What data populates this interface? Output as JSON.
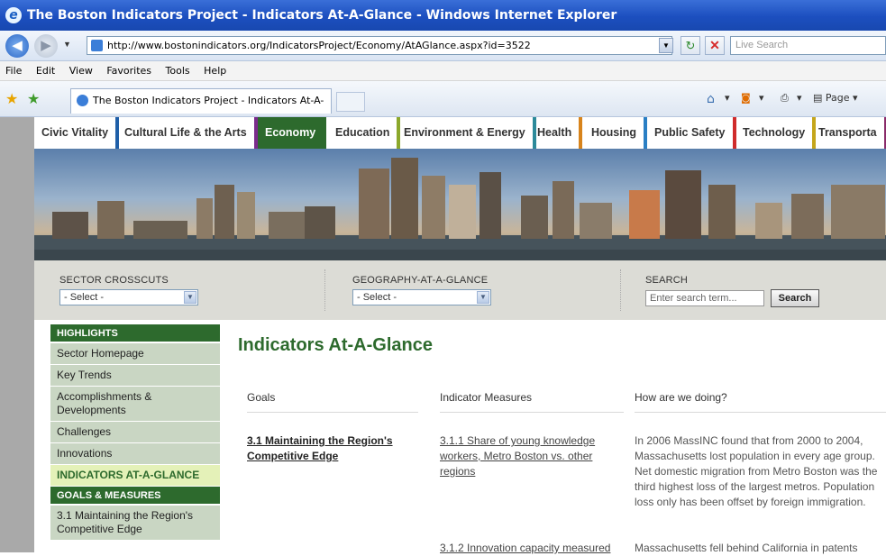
{
  "window": {
    "title": "The Boston Indicators Project - Indicators At-A-Glance - Windows Internet Explorer"
  },
  "browser": {
    "address": "http://www.bostonindicators.org/IndicatorsProject/Economy/AtAGlance.aspx?id=3522",
    "search_placeholder": "Live Search",
    "menu": [
      "File",
      "Edit",
      "View",
      "Favorites",
      "Tools",
      "Help"
    ],
    "tab_title": "The Boston Indicators Project - Indicators At-A-Glance",
    "page_menu": "Page"
  },
  "site": {
    "nav": [
      {
        "label": "Civic Vitality",
        "color": "#1f5fa8"
      },
      {
        "label": "Cultural Life & the Arts",
        "color": "#7b2b8c"
      },
      {
        "label": "Economy",
        "color": "#2d6a2d",
        "active": true
      },
      {
        "label": "Education",
        "color": "#8ca82b"
      },
      {
        "label": "Environment & Energy",
        "color": "#2c8a9a"
      },
      {
        "label": "Health",
        "color": "#d8841b"
      },
      {
        "label": "Housing",
        "color": "#2a7fc4"
      },
      {
        "label": "Public Safety",
        "color": "#d02b2b"
      },
      {
        "label": "Technology",
        "color": "#c5a61b"
      },
      {
        "label": "Transporta",
        "color": "#8a2b6a"
      }
    ],
    "tools": {
      "sector_label": "SECTOR CROSSCUTS",
      "sector_value": "- Select -",
      "geo_label": "GEOGRAPHY-AT-A-GLANCE",
      "geo_value": "- Select -",
      "search_label": "SEARCH",
      "search_placeholder": "Enter search term...",
      "search_button": "Search"
    },
    "sidebar": {
      "head1": "HIGHLIGHTS",
      "items": [
        "Sector Homepage",
        "Key Trends",
        "Accomplishments & Developments",
        "Challenges",
        "Innovations"
      ],
      "active": "INDICATORS AT-A-GLANCE",
      "head2": "GOALS & MEASURES",
      "goal_item": "3.1 Maintaining the Region's Competitive Edge"
    },
    "main": {
      "title": "Indicators At-A-Glance",
      "col_goals": "Goals",
      "col_measures": "Indicator Measures",
      "col_doing": "How are we doing?",
      "goal": "3.1 Maintaining the Region's Competitive Edge",
      "measure1": "3.1.1 Share of young knowledge workers, Metro Boston vs. other regions",
      "doing1": "In 2006 MassINC found that from 2000 to 2004, Massachusetts lost population in every age group. Net domestic migration from Metro Boston was the third highest loss of the largest metros. Population loss only has been offset by foreign immigration.",
      "measure2": "3.1.2 Innovation capacity measured",
      "doing2": "Massachusetts fell behind California in patents"
    }
  }
}
